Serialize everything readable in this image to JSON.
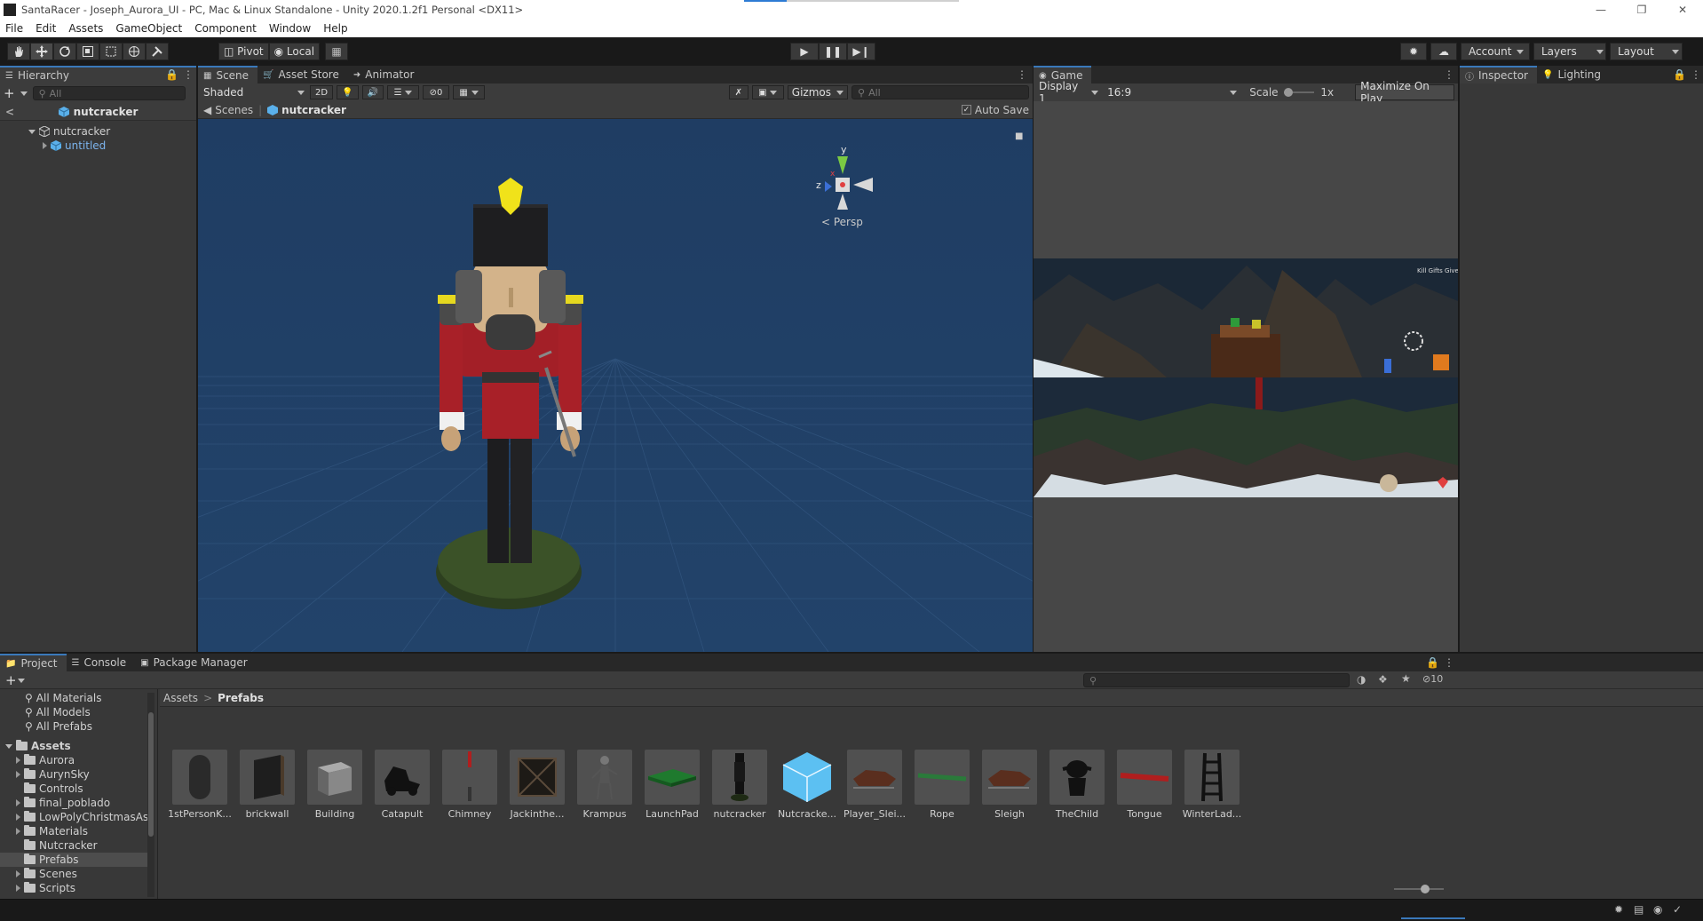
{
  "window": {
    "title": "SantaRacer - Joseph_Aurora_UI - PC, Mac & Linux Standalone - Unity 2020.1.2f1 Personal <DX11>"
  },
  "menu": [
    "File",
    "Edit",
    "Assets",
    "GameObject",
    "Component",
    "Window",
    "Help"
  ],
  "toolbar": {
    "pivot_label": "Pivot",
    "local_label": "Local",
    "account_label": "Account",
    "layers_label": "Layers",
    "layout_label": "Layout"
  },
  "hierarchy": {
    "tab_label": "Hierarchy",
    "search_placeholder": "All",
    "breadcrumb": "nutcracker",
    "items": [
      {
        "label": "nutcracker"
      },
      {
        "label": "untitled"
      }
    ]
  },
  "scene": {
    "tabs": [
      "Scene",
      "Asset Store",
      "Animator"
    ],
    "shading_mode": "Shaded",
    "mode_2d": "2D",
    "hidden_count": "0",
    "gizmos_label": "Gizmos",
    "search_placeholder": "All",
    "crumb_root": "Scenes",
    "crumb_current": "nutcracker",
    "autosave_label": "Auto Save",
    "projection_label": "< Persp",
    "gizmo_axis_y": "y",
    "gizmo_axis_z": "z",
    "gizmo_axis_x": "x"
  },
  "game": {
    "tab_label": "Game",
    "display": "Display 1",
    "aspect": "16:9",
    "scale_label": "Scale",
    "scale_value": "1x",
    "maximize_label": "Maximize On Play",
    "hud_text": "Kill Gifts Given"
  },
  "inspector": {
    "tabs": [
      "Inspector",
      "Lighting"
    ]
  },
  "project": {
    "tabs": [
      "Project",
      "Console",
      "Package Manager"
    ],
    "hidden_count": "10",
    "favorites": [
      "All Materials",
      "All Models",
      "All Prefabs"
    ],
    "assets_root": "Assets",
    "folders": [
      "Aurora",
      "AurynSky",
      "Controls",
      "final_poblado",
      "LowPolyChristmasAs",
      "Materials",
      "Nutcracker",
      "Prefabs",
      "Scenes",
      "Scripts"
    ],
    "selected_folder": "Prefabs",
    "path": [
      "Assets",
      "Prefabs"
    ],
    "assets": [
      "1stPersonK...",
      "brickwall",
      "Building",
      "Catapult",
      "Chimney",
      "Jackinthe...",
      "Krampus",
      "LaunchPad",
      "nutcracker",
      "Nutcracke...",
      "Player_Slei...",
      "Rope",
      "Sleigh",
      "TheChild",
      "Tongue",
      "WinterLad..."
    ]
  },
  "colors": {
    "accent": "#3a79bb",
    "scene_bg": "#1f3d61",
    "panel_bg": "#383838",
    "toolbar_bg": "#191919"
  }
}
